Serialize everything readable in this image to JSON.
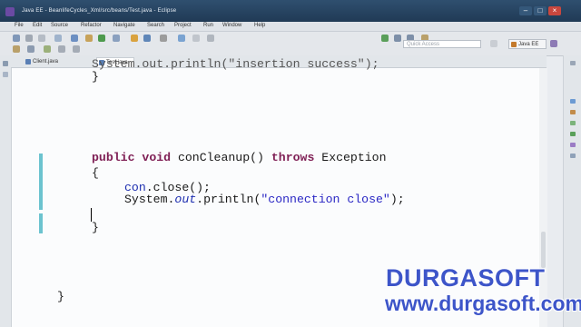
{
  "window": {
    "title": "Java EE - BeanlifeCycles_Xml/src/beans/Test.java - Eclipse"
  },
  "menu": [
    "File",
    "Edit",
    "Source",
    "Refactor",
    "Navigate",
    "Search",
    "Project",
    "Run",
    "Window",
    "Help"
  ],
  "toolbar": {
    "quick_access_placeholder": "Quick Access",
    "perspective_label": "Java EE"
  },
  "tabs": [
    {
      "label": "Client.java",
      "active": false
    },
    {
      "label": "Test.java",
      "active": true
    }
  ],
  "editor": {
    "partial_line": "System.out.println(\"insertion success\");",
    "close_brace_1": "}",
    "method_signature": {
      "kw_public": "public",
      "kw_void": "void",
      "name": "conCleanup()",
      "kw_throws": "throws",
      "exception": "Exception"
    },
    "open_brace": "{",
    "stmt1": {
      "obj": "con",
      "rest": ".close();"
    },
    "stmt2": {
      "class": "System.",
      "field": "out",
      "call": ".println(",
      "arg": "\"connection close\"",
      "end": ");"
    },
    "close_brace_2": "}",
    "class_close_brace": "}"
  },
  "watermark": {
    "brand": "DURGASOFT",
    "url": "www.durgasoft.com"
  },
  "colors": {
    "keyword": "#7f1f55",
    "field": "#1e2fb0",
    "string": "#2a27c4",
    "watermark": "#3d55c9"
  }
}
